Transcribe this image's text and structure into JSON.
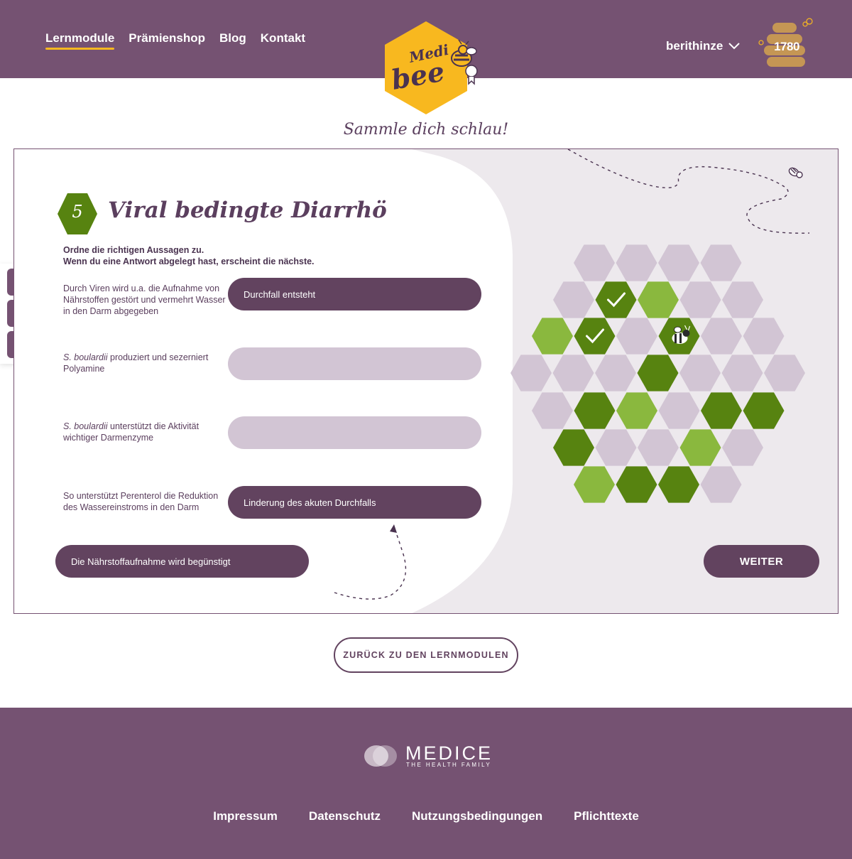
{
  "header": {
    "nav": [
      "Lernmodule",
      "Prämienshop",
      "Blog",
      "Kontakt"
    ],
    "active_nav": "Lernmodule",
    "logo_text_top": "Medi",
    "logo_text_bottom": "bee",
    "username": "berithinze",
    "points": "1780"
  },
  "slogan": "Sammle dich schlau!",
  "social": {
    "icons": [
      "facebook-icon",
      "twitter-icon",
      "mail-icon"
    ]
  },
  "module": {
    "number": "5",
    "title": "Viral bedingte Diarrhö",
    "instruction_line1": "Ordne die richtigen Aussagen zu.",
    "instruction_line2": "Wenn du eine Antwort abgelegt hast, erscheint die nächste.",
    "statements": [
      {
        "italic": "",
        "text": "Durch Viren wird u.a. die Aufnahme von Nährstoffen  gestört und vermehrt Wasser in den Darm abgegeben",
        "answer": "Durchfall entsteht"
      },
      {
        "italic": "S. boulardii",
        "text": " produziert und sezerniert Polyamine",
        "answer": ""
      },
      {
        "italic": "S. boulardii",
        "text": " unterstützt die Aktivität wichtiger Darmenzyme",
        "answer": ""
      },
      {
        "italic": "",
        "text": "So unterstützt Perenterol die Reduktion des Wassereinstroms in den Darm",
        "answer": "Linderung des akuten Durchfalls"
      }
    ],
    "draggable_answer": "Die Nährstoffaufnahme wird begünstigt",
    "next_button": "WEITER"
  },
  "honeycomb": {
    "rows": [
      [
        "empty",
        "empty",
        "empty",
        "empty"
      ],
      [
        "empty",
        "check",
        "light",
        "empty",
        "empty"
      ],
      [
        "light",
        "check",
        "empty",
        "bee",
        "empty",
        "empty"
      ],
      [
        "empty",
        "empty",
        "empty",
        "dark",
        "empty",
        "empty",
        "empty"
      ],
      [
        "empty",
        "dark",
        "light",
        "empty",
        "dark",
        "dark"
      ],
      [
        "dark",
        "empty",
        "empty",
        "light",
        "empty"
      ],
      [
        "light",
        "dark",
        "dark",
        "empty"
      ]
    ]
  },
  "back_button": "ZURÜCK ZU DEN LERNMODULEN",
  "footer": {
    "brand": "MEDICE",
    "tagline": "THE HEALTH FAMILY",
    "links": [
      "Impressum",
      "Datenschutz",
      "Nutzungsbedingungen",
      "Pflichttexte"
    ]
  },
  "colors": {
    "primary": "#755272",
    "dark_pill": "#62435f",
    "accent_yellow": "#f8b81f",
    "hex_empty": "#d2c5d4",
    "hex_light": "#8ab83e",
    "hex_dark": "#578310"
  }
}
